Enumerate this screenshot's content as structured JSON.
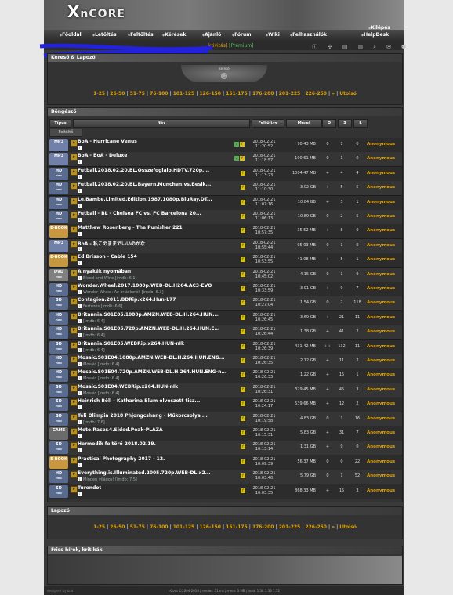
{
  "brand": {
    "logo_x": "X",
    "logo_text": "nCORE"
  },
  "nav": [
    "Főoldal",
    "Letöltés",
    "Feltöltés",
    "Kérések",
    "Ajánló",
    "Fórum",
    "Wiki",
    "Felhasználók",
    "HelpDesk",
    "Kilépés"
  ],
  "header_status": {
    "text": "ktivitás]",
    "premium": "[Prémium]"
  },
  "search": {
    "title": "Kereső & Lapozó",
    "emblem": "kereső"
  },
  "pager": {
    "current": "1-25",
    "pages": [
      "26-50",
      "51-75",
      "76-100",
      "101-125",
      "126-150",
      "151-175",
      "176-200",
      "201-225",
      "226-250"
    ],
    "next": "»",
    "last": "Utolsó"
  },
  "browse": {
    "title": "Böngésző",
    "columns": {
      "type": "Típus",
      "name": "Név",
      "uploaded": "Feltöltve",
      "size": "Méret",
      "o": "O",
      "s": "S",
      "l": "L"
    },
    "uploader_tab": "Feltöltő"
  },
  "torrents": [
    {
      "cat": "MP3",
      "catsub": "",
      "color": "#7080a8",
      "name": "BoA - Hurricane Venus",
      "sub": "",
      "flags": [
        "v",
        "y"
      ],
      "date": "2018-02-21",
      "time": "11:20:52",
      "size": "90.43 MB",
      "c1": "0",
      "c2": "1",
      "c3": "0",
      "uploader": "Anonymous"
    },
    {
      "cat": "MP3",
      "catsub": "",
      "color": "#7080a8",
      "name": "BoA - BoA - Deluxe",
      "sub": "",
      "flags": [
        "v",
        "y"
      ],
      "date": "2018-02-21",
      "time": "11:18:57",
      "size": "100.61 MB",
      "c1": "0",
      "c2": "1",
      "c3": "0",
      "uploader": "Anonymous"
    },
    {
      "cat": "HD",
      "catsub": "HUN",
      "color": "#5a6b90",
      "name": "Futball.2018.02.20.BL.Osszefoglalo.HDTV.720p....",
      "sub": "",
      "flags": [
        "y"
      ],
      "date": "2018-02-21",
      "time": "11:13:23",
      "size": "1004.47 MB",
      "c1": "+",
      "c2": "4",
      "c3": "4",
      "uploader": "Anonymous"
    },
    {
      "cat": "HD",
      "catsub": "HUN",
      "color": "#5a6b90",
      "name": "Futball.2018.02.20.BL.Bayern.Munchen.vs.Besik...",
      "sub": "",
      "flags": [
        "y"
      ],
      "date": "2018-02-21",
      "time": "11:10:30",
      "size": "3.02 GB",
      "c1": "+",
      "c2": "5",
      "c3": "5",
      "uploader": "Anonymous"
    },
    {
      "cat": "HD",
      "catsub": "HUN",
      "color": "#5a6b90",
      "name": "Le.Bambe.Limited.Edition.1987.1080p.BluRay.DT...",
      "sub": "",
      "flags": [
        "y"
      ],
      "date": "2018-02-21",
      "time": "11:07:16",
      "size": "10.84 GB",
      "c1": "+",
      "c2": "3",
      "c3": "1",
      "uploader": "Anonymous"
    },
    {
      "cat": "HD",
      "catsub": "HUN",
      "color": "#5a6b90",
      "name": "Futball - BL - Chelsea FC vs. FC Barcelona 20...",
      "sub": "",
      "flags": [
        "y"
      ],
      "date": "2018-02-21",
      "time": "11:06:13",
      "size": "10.89 GB",
      "c1": "0",
      "c2": "2",
      "c3": "5",
      "uploader": "Anonymous"
    },
    {
      "cat": "E-BOOK",
      "catsub": "",
      "color": "#c89840",
      "name": "Matthew Rosenberg - The Punisher 221",
      "sub": "",
      "flags": [
        "y"
      ],
      "date": "2018-02-21",
      "time": "10:57:35",
      "size": "35.52 MB",
      "c1": "+",
      "c2": "8",
      "c3": "0",
      "uploader": "Anonymous"
    },
    {
      "cat": "MP3",
      "catsub": "",
      "color": "#7080a8",
      "name": "BoA - 私このままでいいのかな",
      "sub": "",
      "flags": [
        "y"
      ],
      "date": "2018-02-21",
      "time": "10:55:44",
      "size": "95.03 MB",
      "c1": "0",
      "c2": "1",
      "c3": "0",
      "uploader": "Anonymous"
    },
    {
      "cat": "E-BOOK",
      "catsub": "",
      "color": "#c89840",
      "name": "Ed Brisson - Cable 154",
      "sub": "",
      "flags": [
        "y"
      ],
      "date": "2018-02-21",
      "time": "10:53:55",
      "size": "41.08 MB",
      "c1": "+",
      "c2": "5",
      "c3": "1",
      "uploader": "Anonymous"
    },
    {
      "cat": "DVD",
      "catsub": "HUN",
      "color": "#808080",
      "name": "A nyakék nyomában",
      "sub": "Blood and Wine [imdb: 6.1]",
      "flags": [
        "y"
      ],
      "date": "2018-02-21",
      "time": "10:45:02",
      "size": "4.15 GB",
      "c1": "0",
      "c2": "1",
      "c3": "9",
      "uploader": "Anonymous"
    },
    {
      "cat": "HD",
      "catsub": "HUN",
      "color": "#5a6b90",
      "name": "Wonder.Wheel.2017.1080p.WEB-DL.H264.AC3-EVO",
      "sub": "Wonder Wheel: Az óriáskerék [imdb: 6.3]",
      "flags": [
        "y"
      ],
      "date": "2018-02-21",
      "time": "10:33:59",
      "size": "3.91 GB",
      "c1": "+",
      "c2": "9",
      "c3": "7",
      "uploader": "Anonymous"
    },
    {
      "cat": "SD",
      "catsub": "HUN",
      "color": "#5a6b90",
      "name": "Contagion.2011.BDRip.x264.Hun-L77",
      "sub": "Fertőzés [imdb: 6.6]",
      "flags": [
        "y"
      ],
      "date": "2018-02-21",
      "time": "10:27:04",
      "size": "1.54 GB",
      "c1": "0",
      "c2": "2",
      "c3": "118",
      "uploader": "Anonymous"
    },
    {
      "cat": "HD",
      "catsub": "HUN",
      "color": "#5a6b90",
      "name": "Britannia.S01E05.1080p.AMZN.WEB-DL.H.264.HUN....",
      "sub": "[imdb: 6.4]",
      "flags": [
        "y"
      ],
      "date": "2018-02-21",
      "time": "10:26:45",
      "size": "3.69 GB",
      "c1": "+",
      "c2": "21",
      "c3": "11",
      "uploader": "Anonymous"
    },
    {
      "cat": "HD",
      "catsub": "HUN",
      "color": "#5a6b90",
      "name": "Britannia.S01E05.720p.AMZN.WEB-DL.H.264.HUN.E...",
      "sub": "[imdb: 6.4]",
      "flags": [
        "y"
      ],
      "date": "2018-02-21",
      "time": "10:26:44",
      "size": "1.38 GB",
      "c1": "+",
      "c2": "41",
      "c3": "2",
      "uploader": "Anonymous"
    },
    {
      "cat": "SD",
      "catsub": "HUN",
      "color": "#5a6b90",
      "name": "Britannia.S01E05.WEBRip.x264.HUN-nIk",
      "sub": "[imdb: 6.4]",
      "flags": [
        "y"
      ],
      "date": "2018-02-21",
      "time": "10:26:39",
      "size": "431.42 MB",
      "c1": "++",
      "c2": "132",
      "c3": "11",
      "uploader": "Anonymous"
    },
    {
      "cat": "HD",
      "catsub": "HUN",
      "color": "#5a6b90",
      "name": "Mosaic.S01E04.1080p.AMZN.WEB-DL.H.264.HUN.ENG...",
      "sub": "Mosaic [imdb: 6.4]",
      "flags": [
        "y"
      ],
      "date": "2018-02-21",
      "time": "10:26:35",
      "size": "2.12 GB",
      "c1": "+",
      "c2": "11",
      "c3": "2",
      "uploader": "Anonymous"
    },
    {
      "cat": "HD",
      "catsub": "HUN",
      "color": "#5a6b90",
      "name": "Mosaic.S01E04.720p.AMZN.WEB-DL.H.264.HUN.ENG-n...",
      "sub": "Mosaic [imdb: 6.4]",
      "flags": [
        "y"
      ],
      "date": "2018-02-21",
      "time": "10:26:33",
      "size": "1.22 GB",
      "c1": "+",
      "c2": "15",
      "c3": "1",
      "uploader": "Anonymous"
    },
    {
      "cat": "SD",
      "catsub": "HUN",
      "color": "#5a6b90",
      "name": "Mosaic.S01E04.WEBRip.x264.HUN-nIk",
      "sub": "Mosaic [imdb: 6.4]",
      "flags": [
        "y"
      ],
      "date": "2018-02-21",
      "time": "10:26:31",
      "size": "329.45 MB",
      "c1": "+",
      "c2": "45",
      "c3": "3",
      "uploader": "Anonymous"
    },
    {
      "cat": "SD",
      "catsub": "HUN",
      "color": "#5a6b90",
      "name": "Heinrich Böll - Katharina Blum elveszett tisz...",
      "sub": "",
      "flags": [
        "y"
      ],
      "date": "2018-02-21",
      "time": "10:24:17",
      "size": "539.66 MB",
      "c1": "+",
      "c2": "12",
      "c3": "2",
      "uploader": "Anonymous"
    },
    {
      "cat": "SD",
      "catsub": "HUN",
      "color": "#5a6b90",
      "name": "Téli Olimpia 2018 Phjongcshang - Műkorcsolya ...",
      "sub": "[imdb: 7.6]",
      "flags": [
        "y"
      ],
      "date": "2018-02-21",
      "time": "10:19:58",
      "size": "4.83 GB",
      "c1": "0",
      "c2": "1",
      "c3": "16",
      "uploader": "Anonymous"
    },
    {
      "cat": "GAME",
      "catsub": "",
      "color": "#6b6b6b",
      "name": "Moto.Racer.4.Sided.Peak-PLAZA",
      "sub": "",
      "flags": [
        "y"
      ],
      "date": "2018-02-21",
      "time": "10:15:31",
      "size": "5.83 GB",
      "c1": "+",
      "c2": "31",
      "c3": "7",
      "uploader": "Anonymous"
    },
    {
      "cat": "SD",
      "catsub": "HUN",
      "color": "#5a6b90",
      "name": "Hermedik feltörő 2018.02.19.",
      "sub": "",
      "flags": [
        "y"
      ],
      "date": "2018-02-21",
      "time": "10:13:14",
      "size": "1.31 GB",
      "c1": "+",
      "c2": "9",
      "c3": "0",
      "uploader": "Anonymous"
    },
    {
      "cat": "E-BOOK",
      "catsub": "",
      "color": "#c89840",
      "name": "Practical Photography 2017 - 12.",
      "sub": "",
      "flags": [
        "y"
      ],
      "date": "2018-02-21",
      "time": "10:09:39",
      "size": "56.37 MB",
      "c1": "0",
      "c2": "0",
      "c3": "22",
      "uploader": "Anonymous"
    },
    {
      "cat": "HD",
      "catsub": "HUN",
      "color": "#5a6b90",
      "name": "Everything.is.Illuminated.2005.720p.WEB-DL.x2...",
      "sub": "Minden világos! [imdb: 7.5]",
      "flags": [
        "y"
      ],
      "date": "2018-02-21",
      "time": "10:03:40",
      "size": "5.79 GB",
      "c1": "0",
      "c2": "1",
      "c3": "52",
      "uploader": "Anonymous"
    },
    {
      "cat": "SD",
      "catsub": "HUN",
      "color": "#5a6b90",
      "name": "Turendot",
      "sub": "",
      "flags": [
        "y"
      ],
      "date": "2018-02-21",
      "time": "10:03:35",
      "size": "868.33 MB",
      "c1": "+",
      "c2": "15",
      "c3": "3",
      "uploader": "Anonymous"
    }
  ],
  "lapozo": {
    "title": "Lapozó"
  },
  "news": {
    "title": "Friss hírek, kritikák"
  },
  "footer": {
    "left": "designed by bud",
    "text": "nCore ©2004-2018 | render: 51 ms | mem: 3 MB | load: 1.38 1.33 1.52"
  }
}
